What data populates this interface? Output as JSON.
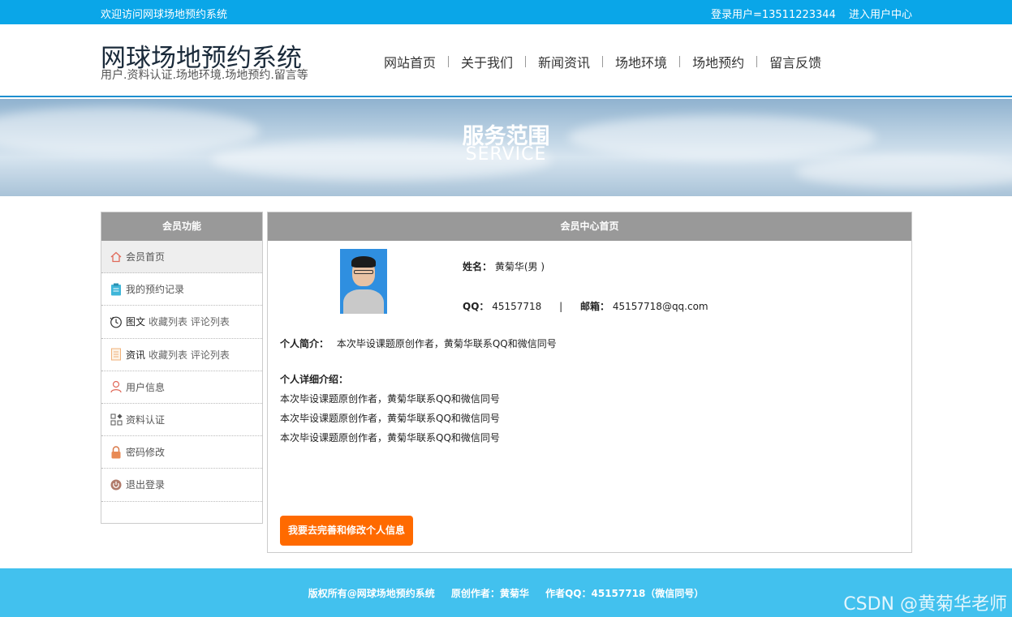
{
  "topbar": {
    "welcome": "欢迎访问网球场地预约系统",
    "login_user": "登录用户=13511223344",
    "user_center": "进入用户中心"
  },
  "header": {
    "title": "网球场地预约系统",
    "subtitle": "用户.资料认证.场地环境.场地预约.留言等",
    "nav": [
      "网站首页",
      "关于我们",
      "新闻资讯",
      "场地环境",
      "场地预约",
      "留言反馈"
    ]
  },
  "banner": {
    "title": "服务范围",
    "subtitle": "SERVICE"
  },
  "sidebar": {
    "heading": "会员功能",
    "items": [
      {
        "icon": "home-icon",
        "label": "会员首页"
      },
      {
        "icon": "clipboard-icon",
        "label": "我的预约记录"
      },
      {
        "icon": "history-icon",
        "label": "图文",
        "sub": "收藏列表 评论列表"
      },
      {
        "icon": "document-icon",
        "label": "资讯",
        "sub": "收藏列表 评论列表"
      },
      {
        "icon": "user-icon",
        "label": "用户信息"
      },
      {
        "icon": "grid-icon",
        "label": "资料认证"
      },
      {
        "icon": "lock-icon",
        "label": "密码修改"
      },
      {
        "icon": "power-icon",
        "label": "退出登录"
      }
    ]
  },
  "main": {
    "heading": "会员中心首页",
    "name_label": "姓名：",
    "name_value": "黄菊华(男 )",
    "qq_label": "QQ：",
    "qq_value": "45157718",
    "divider": "|",
    "email_label": "邮箱：",
    "email_value": "45157718@qq.com",
    "intro_label": "个人简介：",
    "intro_value": "本次毕设课题原创作者，黄菊华联系QQ和微信同号",
    "detail_label": "个人详细介绍：",
    "detail_lines": [
      "本次毕设课题原创作者，黄菊华联系QQ和微信同号",
      "本次毕设课题原创作者，黄菊华联系QQ和微信同号",
      "本次毕设课题原创作者，黄菊华联系QQ和微信同号"
    ],
    "edit_button": "我要去完善和修改个人信息"
  },
  "footer": {
    "copyright": "版权所有@网球场地预约系统",
    "author": "原创作者：黄菊华",
    "qq": "作者QQ：45157718（微信同号）"
  },
  "watermark": "CSDN @黄菊华老师",
  "colors": {
    "topbar": "#0aa6e8",
    "footer": "#42c1ee",
    "button": "#ff6a00",
    "panel_head": "#999999"
  }
}
